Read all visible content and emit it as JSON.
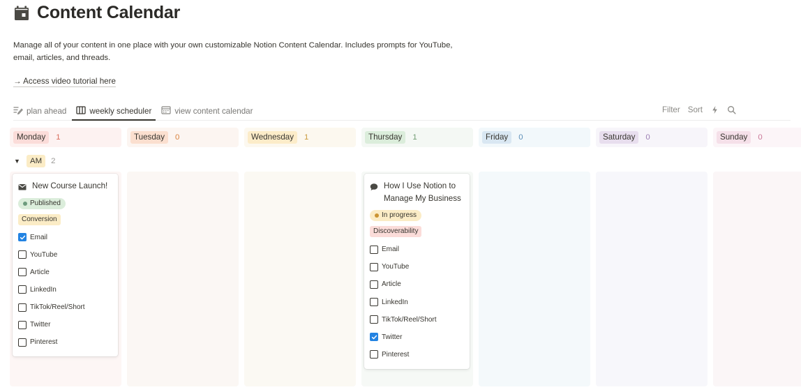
{
  "page": {
    "title": "Content Calendar",
    "icon": "calendar-icon",
    "description": "Manage all of your content in one place with your own customizable Notion Content Calendar. Includes prompts for YouTube, email, articles, and threads.",
    "tutorial_link": "→ Access video tutorial here"
  },
  "tabs": [
    {
      "label": "plan ahead",
      "icon": "list-edit-icon",
      "active": false
    },
    {
      "label": "weekly scheduler",
      "icon": "board-columns-icon",
      "active": true
    },
    {
      "label": "view content calendar",
      "icon": "calendar-grid-icon",
      "active": false
    }
  ],
  "actions": {
    "filter": "Filter",
    "sort": "Sort",
    "automation_icon": "lightning-icon",
    "search_icon": "search-icon"
  },
  "columns": [
    {
      "day": "Monday",
      "count": "1",
      "pill_bg": "#fbdcd9",
      "header_bg": "#fdf2f1",
      "count_color": "#d86b5c",
      "body_bg": "#fdf6f5"
    },
    {
      "day": "Tuesday",
      "count": "0",
      "pill_bg": "#fbdfcf",
      "header_bg": "#fcf5f1",
      "count_color": "#d9823e",
      "body_bg": "#fbf7f4"
    },
    {
      "day": "Wednesday",
      "count": "1",
      "pill_bg": "#fcecc9",
      "header_bg": "#fcf8ef",
      "count_color": "#c99a3c",
      "body_bg": "#fbf9f3"
    },
    {
      "day": "Thursday",
      "count": "1",
      "pill_bg": "#dbeddb",
      "header_bg": "#f4f8f4",
      "count_color": "#6f9b71",
      "body_bg": "#f6f9f6"
    },
    {
      "day": "Friday",
      "count": "0",
      "pill_bg": "#d9e7f2",
      "header_bg": "#f2f8fb",
      "count_color": "#5d8fb8",
      "body_bg": "#f4f9fb"
    },
    {
      "day": "Saturday",
      "count": "0",
      "pill_bg": "#e8deee",
      "header_bg": "#f7f5fa",
      "count_color": "#9c7eb3",
      "body_bg": "#f7f7fb"
    },
    {
      "day": "Sunday",
      "count": "0",
      "pill_bg": "#f5e0e9",
      "header_bg": "#fcf5f8",
      "count_color": "#c97898",
      "body_bg": "#fbf6f7"
    }
  ],
  "group": {
    "label": "AM",
    "count": "2"
  },
  "cards": [
    {
      "column": 0,
      "icon": "envelope-icon",
      "title": "New Course Launch!",
      "status": {
        "label": "Published",
        "bg": "#dbeddb",
        "dot": "#6c9b7d"
      },
      "tag": {
        "label": "Conversion",
        "bg": "#fbecc6"
      },
      "checklist": [
        {
          "label": "Email",
          "checked": true
        },
        {
          "label": "YouTube",
          "checked": false
        },
        {
          "label": "Article",
          "checked": false
        },
        {
          "label": "LinkedIn",
          "checked": false
        },
        {
          "label": "TikTok/Reel/Short",
          "checked": false
        },
        {
          "label": "Twitter",
          "checked": false
        },
        {
          "label": "Pinterest",
          "checked": false
        }
      ]
    },
    {
      "column": 3,
      "icon": "speech-bubble-icon",
      "title": "How I Use Notion to Manage My Business",
      "status": {
        "label": "In progress",
        "bg": "#fbecc6",
        "dot": "#cb9433"
      },
      "tag": {
        "label": "Discoverability",
        "bg": "#fbdcd9"
      },
      "checklist": [
        {
          "label": "Email",
          "checked": false
        },
        {
          "label": "YouTube",
          "checked": false
        },
        {
          "label": "Article",
          "checked": false
        },
        {
          "label": "LinkedIn",
          "checked": false
        },
        {
          "label": "TikTok/Reel/Short",
          "checked": false
        },
        {
          "label": "Twitter",
          "checked": true
        },
        {
          "label": "Pinterest",
          "checked": false
        }
      ]
    }
  ]
}
